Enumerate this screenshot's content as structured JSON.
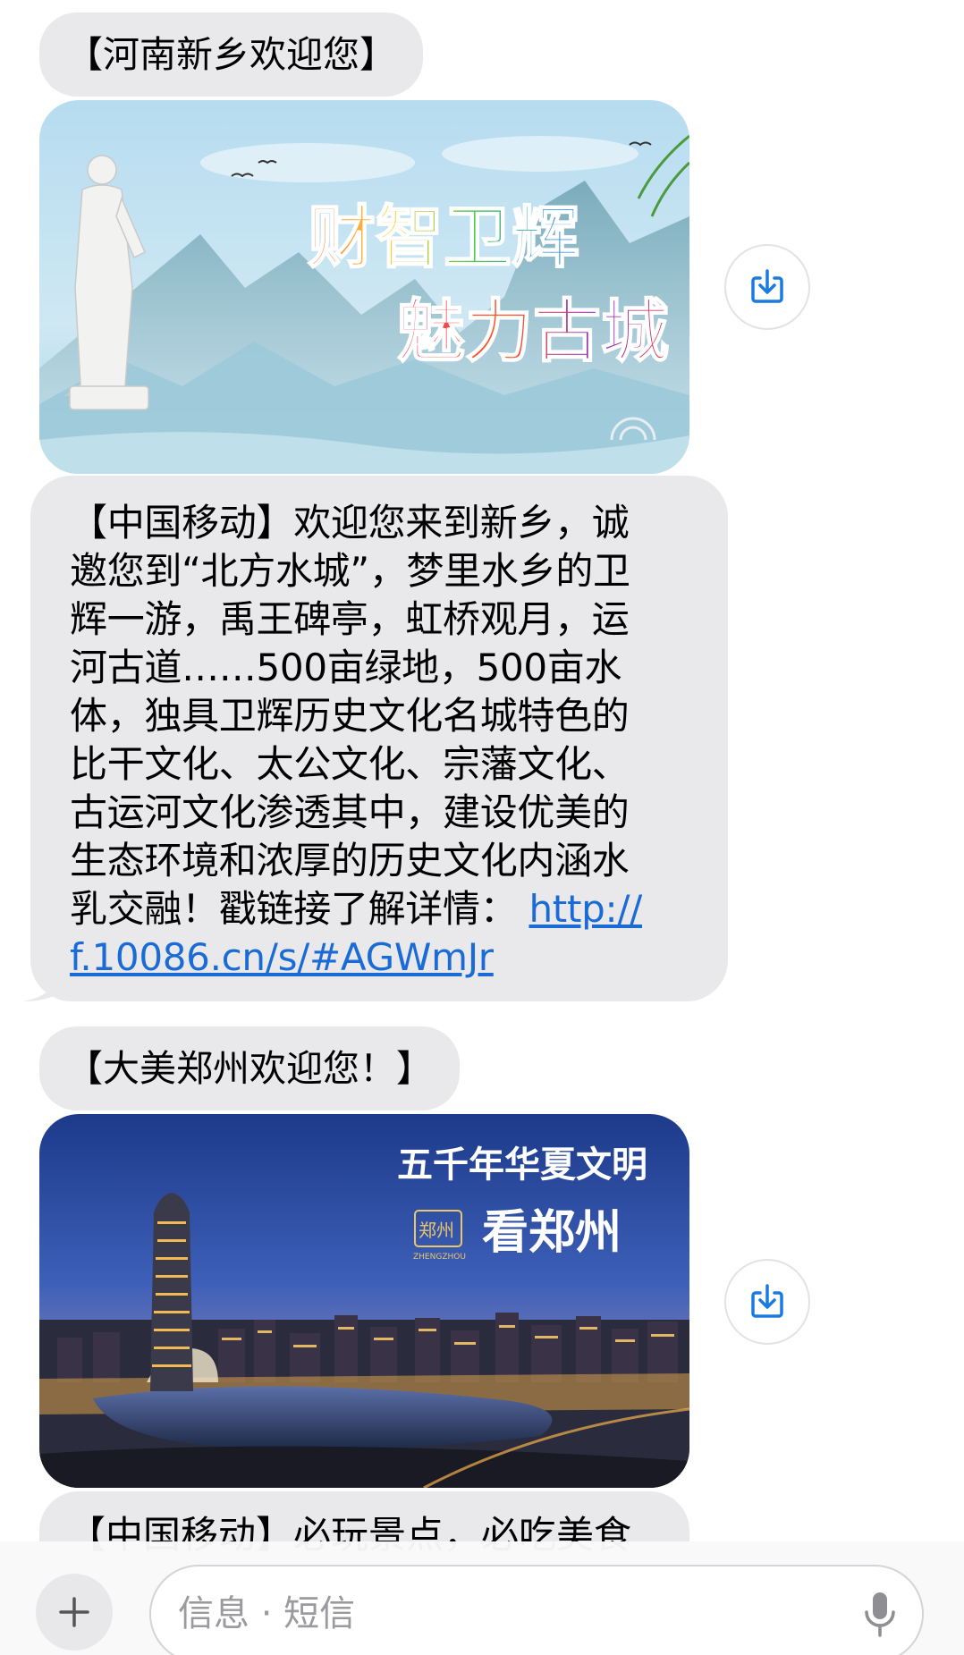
{
  "messages": {
    "greeting_xinxiang": "【河南新乡欢迎您】",
    "banner_xinxiang": {
      "line1": "财智卫辉",
      "line2": "魅力古城"
    },
    "sms_xinxiang": {
      "text": "【中国移动】欢迎您来到新乡，诚\n邀您到“北方水城”，梦里水乡的卫\n辉一游，禹王碑亭，虹桥观月，运\n河古道……500亩绿地，500亩水\n体，独具卫辉历史文化名城特色的\n比干文化、太公文化、宗藩文化、\n古运河文化渗透其中，建设优美的\n生态环境和浓厚的历史文化内涵水\n乳交融！戳链接了解详情： ",
      "link_line1": "http://",
      "link_line2": "f.10086.cn/s/#AGWmJr"
    },
    "greeting_zhengzhou": "【大美郑州欢迎您！】",
    "banner_zhengzhou": {
      "line1": "五千年华夏文明",
      "line2": "看郑州",
      "seal": "郑州",
      "seal_caption": "ZHENGZHOU"
    },
    "sms_zhengzhou_partial": "【中国移动】必玩景点，必吃美食"
  },
  "input_bar": {
    "placeholder": "信息 · 短信",
    "value": ""
  },
  "colors": {
    "bubble": "#e9e9eb",
    "link": "#1a6bd6",
    "icon": "#1a7ae0"
  },
  "icons": [
    "download-icon",
    "plus-icon",
    "microphone-icon"
  ]
}
